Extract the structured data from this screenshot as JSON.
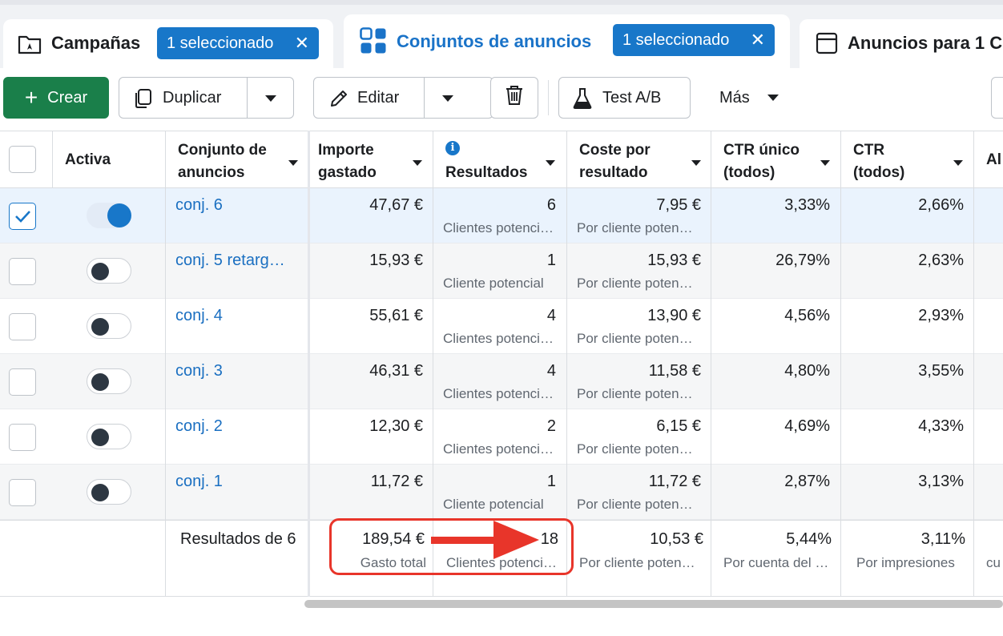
{
  "tabs": [
    {
      "title": "Campañas",
      "badge": "1 seleccionado",
      "close": "✕"
    },
    {
      "title": "Conjuntos de anuncios",
      "badge": "1 seleccionado",
      "close": "✕"
    },
    {
      "title": "Anuncios para 1 C"
    }
  ],
  "toolbar": {
    "create": "Crear",
    "duplicate": "Duplicar",
    "edit": "Editar",
    "ab_test": "Test A/B",
    "more": "Más"
  },
  "columns": {
    "active": "Activa",
    "adset_l1": "Conjunto de",
    "adset_l2": "anuncios",
    "spent_l1": "Importe",
    "spent_l2": "gastado",
    "results": "Resultados",
    "cpr_l1": "Coste por",
    "cpr_l2": "resultado",
    "uctr_l1": "CTR único",
    "uctr_l2": "(todos)",
    "ctr_l1": "CTR",
    "ctr_l2": "(todos)",
    "cut": "Al"
  },
  "rows": [
    {
      "name": "conj. 6",
      "spent": "47,67 €",
      "results": "6",
      "results_sub": "Clientes potenciales",
      "cpr": "7,95 €",
      "cpr_sub": "Por cliente potencial",
      "uctr": "3,33%",
      "ctr": "2,66%",
      "selected": true,
      "active": true
    },
    {
      "name": "conj. 5 retarg…",
      "spent": "15,93 €",
      "results": "1",
      "results_sub": "Cliente potencial",
      "cpr": "15,93 €",
      "cpr_sub": "Por cliente potencial",
      "uctr": "26,79%",
      "ctr": "2,63%",
      "selected": false,
      "active": false
    },
    {
      "name": "conj. 4",
      "spent": "55,61 €",
      "results": "4",
      "results_sub": "Clientes potenciales",
      "cpr": "13,90 €",
      "cpr_sub": "Por cliente potencial",
      "uctr": "4,56%",
      "ctr": "2,93%",
      "selected": false,
      "active": false
    },
    {
      "name": "conj. 3",
      "spent": "46,31 €",
      "results": "4",
      "results_sub": "Clientes potenciales",
      "cpr": "11,58 €",
      "cpr_sub": "Por cliente potencial",
      "uctr": "4,80%",
      "ctr": "3,55%",
      "selected": false,
      "active": false
    },
    {
      "name": "conj. 2",
      "spent": "12,30 €",
      "results": "2",
      "results_sub": "Clientes potenciales",
      "cpr": "6,15 €",
      "cpr_sub": "Por cliente potencial",
      "uctr": "4,69%",
      "ctr": "4,33%",
      "selected": false,
      "active": false
    },
    {
      "name": "conj. 1",
      "spent": "11,72 €",
      "results": "1",
      "results_sub": "Cliente potencial",
      "cpr": "11,72 €",
      "cpr_sub": "Por cliente potencial",
      "uctr": "2,87%",
      "ctr": "3,13%",
      "selected": false,
      "active": false
    }
  ],
  "summary": {
    "label": "Resultados de 6",
    "spent": "189,54 €",
    "spent_sub": "Gasto total",
    "results": "18",
    "results_sub": "Clientes potenciales",
    "cpr": "10,53 €",
    "cpr_sub": "Por cliente potencial",
    "uctr": "5,44%",
    "uctr_sub": "Por cuenta del Centro de cuentas",
    "ctr": "3,11%",
    "ctr_sub": "Por impresiones",
    "cut_sub": "cu"
  },
  "colors": {
    "accent": "#1877c9",
    "create": "#1a7f4a",
    "highlight": "#e8352a",
    "selected_row": "#eaf3fd",
    "alt_row": "#f5f6f7"
  }
}
